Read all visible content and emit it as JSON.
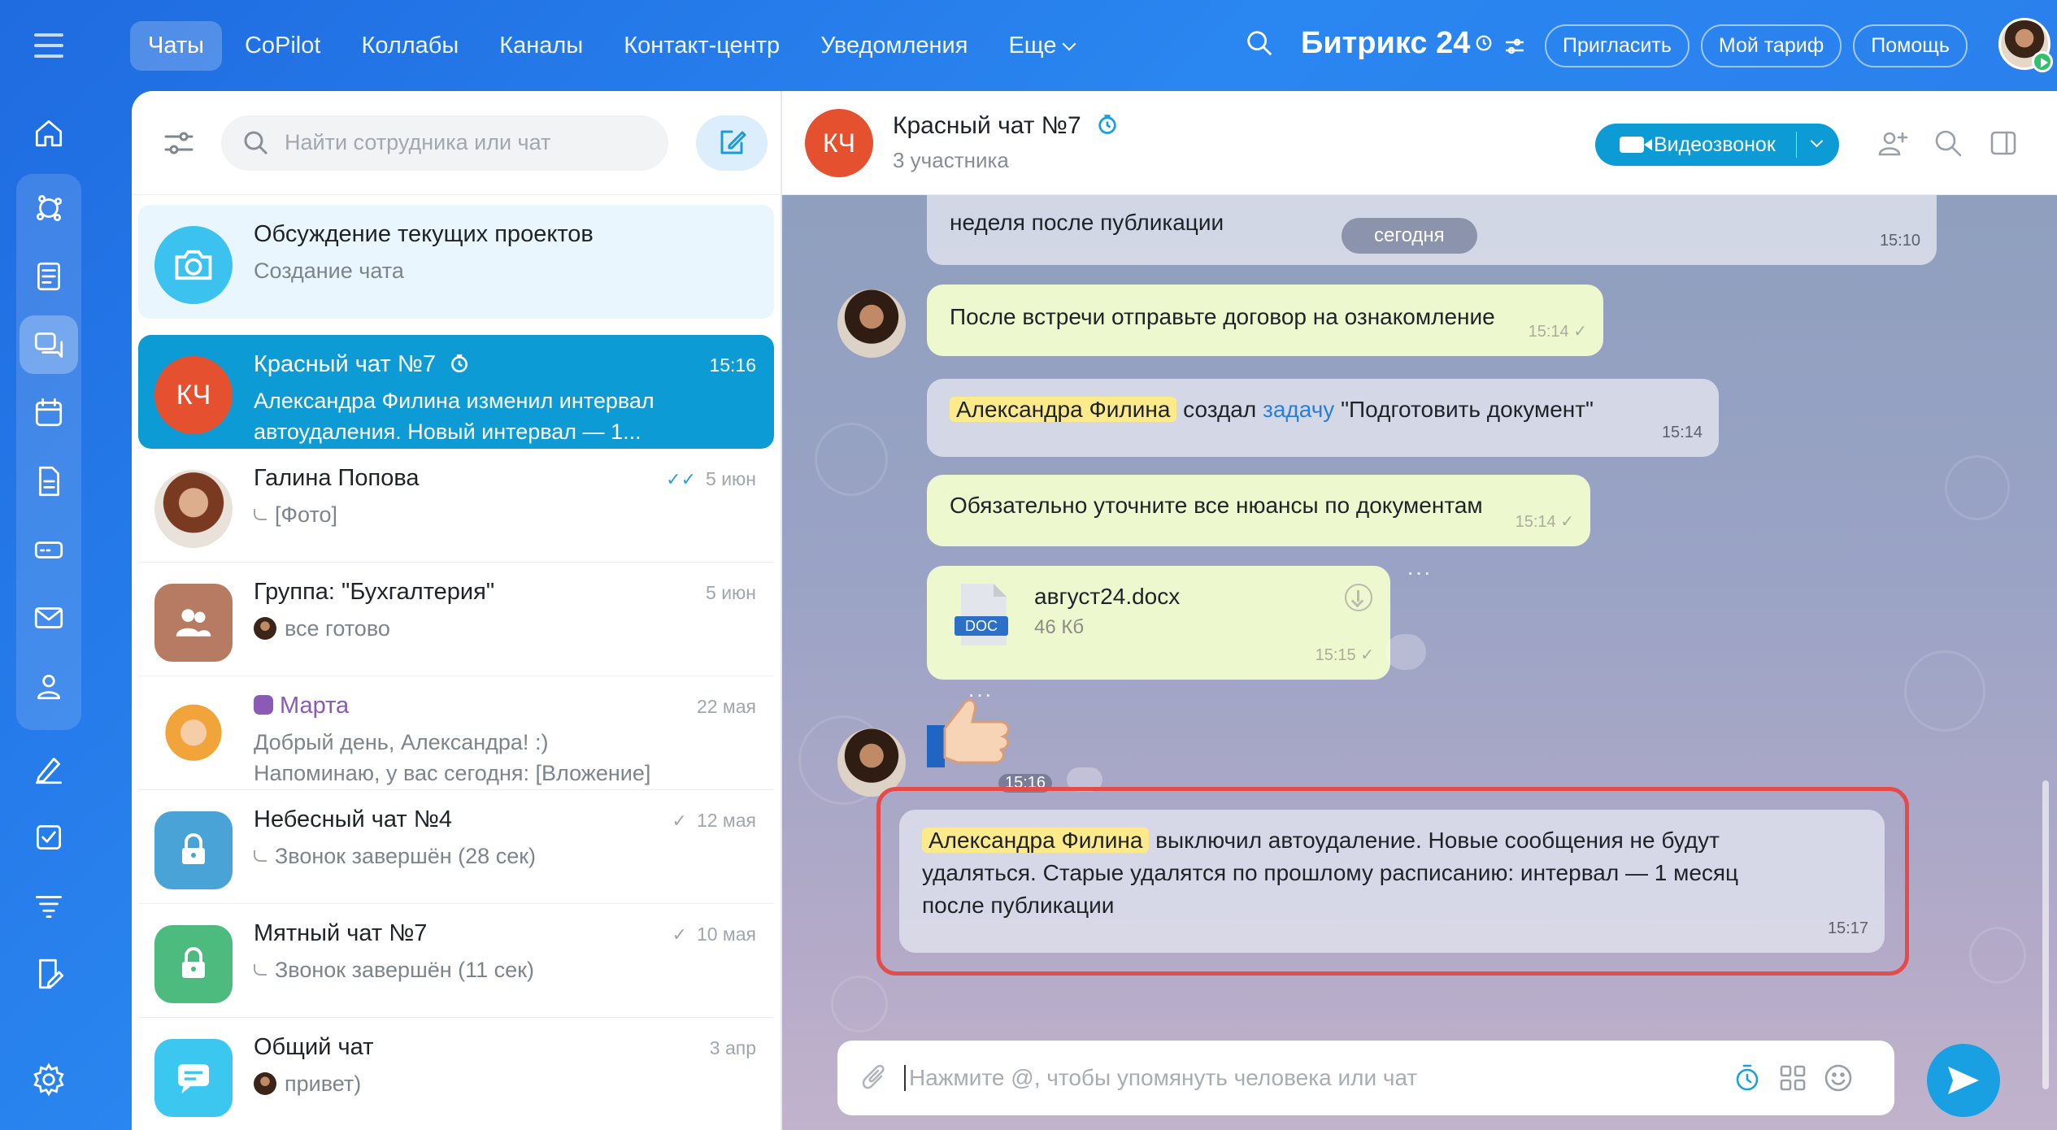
{
  "topbar": {
    "tabs": [
      "Чаты",
      "CoPilot",
      "Коллабы",
      "Каналы",
      "Контакт-центр",
      "Уведомления",
      "Еще"
    ],
    "brand": "Битрикс 24",
    "buttons": [
      "Пригласить",
      "Мой тариф",
      "Помощь"
    ]
  },
  "sidebar_icons": [
    "home-icon",
    "ai-icon",
    "feed-icon",
    "chat-icon",
    "calendar-icon",
    "docs-icon",
    "drive-icon",
    "mail-icon",
    "users-icon",
    "sign-icon",
    "tasks-icon",
    "filter-icon",
    "form-icon",
    "settings-icon"
  ],
  "list": {
    "search_placeholder": "Найти сотрудника или чат",
    "items": [
      {
        "name": "Обсуждение текущих проектов",
        "sub": "Создание чата",
        "time": "",
        "avatar_color": "#3bc2ef"
      },
      {
        "name": "Красный чат №7",
        "sub1": "Александра Филина изменил интервал",
        "sub2": "автоудаления. Новый интервал — 1...",
        "time": "15:16",
        "initials": "КЧ",
        "avatar_color": "#e5512e"
      },
      {
        "name": "Галина Попова",
        "sub": "[Фото]",
        "time": "5 июн"
      },
      {
        "name": "Группа: \"Бухгалтерия\"",
        "sub": "все готово",
        "time": "5 июн",
        "avatar_color": "#b77b63"
      },
      {
        "name": "Марта",
        "sub1": "Добрый день, Александра! :)",
        "sub2": "Напоминаю, у вас сегодня: [Вложение]",
        "time": "22 мая",
        "name_color": "#8a5ab5"
      },
      {
        "name": "Небесный чат №4",
        "sub": "Звонок завершён (28 сек)",
        "time": "12 мая",
        "avatar_color": "#4aa3d6"
      },
      {
        "name": "Мятный чат №7",
        "sub": "Звонок завершён (11 сек)",
        "time": "10 мая",
        "avatar_color": "#4dbb7e"
      },
      {
        "name": "Общий чат",
        "sub": "привет)",
        "time": "3 апр",
        "avatar_color": "#3cc7f0"
      }
    ]
  },
  "chat": {
    "title": "Красный чат №7",
    "initials": "КЧ",
    "members": "3 участника",
    "video_label": "Видеозвонок",
    "date_pill": "сегодня",
    "messages": [
      {
        "text": "неделя после публикации",
        "time": "15:10"
      },
      {
        "text": "После встречи отправьте договор на ознакомление",
        "time": "15:14"
      },
      {
        "mention": "Александра Филина",
        "pre": "создал",
        "link": "задачу",
        "post": "\"Подготовить документ\"",
        "time": "15:14"
      },
      {
        "text": "Обязательно уточните все нюансы по документам",
        "time": "15:14"
      },
      {
        "file_name": "август24.docx",
        "file_size": "46 Кб",
        "file_ext": "DOC",
        "time": "15:15"
      },
      {
        "time": "15:16"
      },
      {
        "mention": "Александра Филина",
        "line1": "выключил автоудаление. Новые сообщения не будут",
        "line2": "удаляться. Старые удалятся по прошлому расписанию: интервал — 1 месяц",
        "line3": "после публикации",
        "time": "15:17"
      }
    ],
    "input_placeholder": "Нажмите @, чтобы упомянуть человека или чат"
  }
}
